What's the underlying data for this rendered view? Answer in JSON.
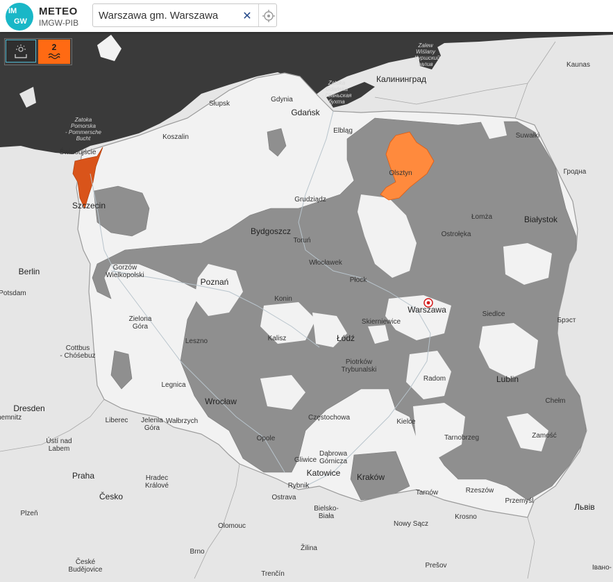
{
  "header": {
    "logo_text_top": "IM",
    "logo_text_bottom": "GW",
    "brand_title": "METEO",
    "brand_subtitle": "IMGW-PIB"
  },
  "search": {
    "value": "Warszawa gm. Warszawa",
    "clear_icon": "close-icon",
    "locate_icon": "target-icon"
  },
  "layers": {
    "left_icon": "sun-over-land-icon",
    "warning_level": "2",
    "warning_icon": "water-waves-icon",
    "warning_color": "#ff6a13"
  },
  "colors": {
    "sea": "#3a3a3a",
    "land_outside": "#e6e6e6",
    "poland": "#f2f2f2",
    "warning_level_1_fill": "#8f8f8f",
    "warning_level_2_fill": "#ff8a3d"
  },
  "map": {
    "selected_location": "Warszawa",
    "places": [
      "Kaunas",
      "Калининград",
      "Suwałki",
      "Гродна",
      "Białystok",
      "Łomża",
      "Ostrołęka",
      "Olsztyn",
      "Elbląg",
      "Gdańsk",
      "Gdynia",
      "Słupsk",
      "Koszalin",
      "Świnoujście",
      "Szczecin",
      "Gorzów Wielkopolski",
      "Berlin",
      "Potsdam",
      "Grudziądz",
      "Bydgoszcz",
      "Toruń",
      "Włocławek",
      "Płock",
      "Poznań",
      "Konin",
      "Warszawa",
      "Skierniewice",
      "Siedlce",
      "Брэст",
      "Łódź",
      "Kalisz",
      "Leszno",
      "Zielona Góra",
      "Cottbus - Chóśebuz",
      "Dresden",
      "Piotrków Trybunalski",
      "Radom",
      "Lublin",
      "Chełm",
      "Kielce",
      "Tarnobrzeg",
      "Zamość",
      "Legnica",
      "Wrocław",
      "Liberec",
      "Jelenia Góra",
      "Wałbrzych",
      "Ústí nad Labem",
      "Opole",
      "Częstochowa",
      "Gliwice",
      "Dąbrowa Górnicza",
      "Katowice",
      "Kraków",
      "Tarnów",
      "Rzeszów",
      "Przemyśl",
      "Rybnik",
      "Ostrava",
      "Bielsko-Biała",
      "Nowy Sącz",
      "Krosno",
      "Praha",
      "Hradec Králové",
      "Česko",
      "Olomouc",
      "Plzeň",
      "Brno",
      "České Budějovice",
      "Žilina",
      "Prešov",
      "Trenčín",
      "Львів",
      "Івано-",
      "Chemnitz"
    ],
    "sea_labels": [
      "Zatoka Pomorska - Pommersche Bucht",
      "Zatoka Gdańska - Гданьская бухта",
      "Zalew Wiślany - Калининградский залив"
    ]
  }
}
